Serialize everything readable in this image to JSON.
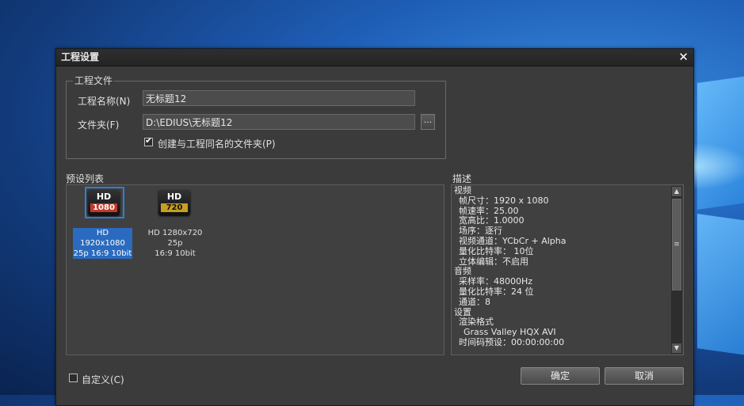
{
  "dialog": {
    "title": "工程设置",
    "close": "✕"
  },
  "project_file": {
    "group_title": "工程文件",
    "name_label": "工程名称(N)",
    "name_value": "无标题12",
    "folder_label": "文件夹(F)",
    "folder_value": "D:\\EDIUS\\无标题12",
    "browse_label": "...",
    "create_folder_checked": true,
    "create_folder_label": "创建与工程同名的文件夹(P)"
  },
  "presets": {
    "section_label": "预设列表",
    "items": [
      {
        "badge_top": "HD",
        "badge_bottom": "1080",
        "caption_line1": "HD 1920x1080",
        "caption_line2": "25p 16:9 10bit",
        "selected": true
      },
      {
        "badge_top": "HD",
        "badge_bottom": "720",
        "caption_line1": "HD 1280x720 25p",
        "caption_line2": "16:9 10bit",
        "selected": false
      }
    ]
  },
  "description": {
    "section_label": "描述",
    "lines": [
      "视频",
      "帧尺寸：1920 x 1080",
      "帧速率：25.00",
      "宽高比：1.0000",
      "场序：逐行",
      "视频通道：YCbCr + Alpha",
      "量化比特率： 10位",
      "立体编辑：不启用",
      "音频",
      "采样率：48000Hz",
      "量化比特率：24 位",
      "通道：8",
      "设置",
      "渲染格式",
      "Grass Valley HQX AVI",
      "时间码预设：00:00:00:00"
    ]
  },
  "custom": {
    "label": "自定义(C)",
    "checked": false
  },
  "buttons": {
    "ok": "确定",
    "cancel": "取消"
  }
}
